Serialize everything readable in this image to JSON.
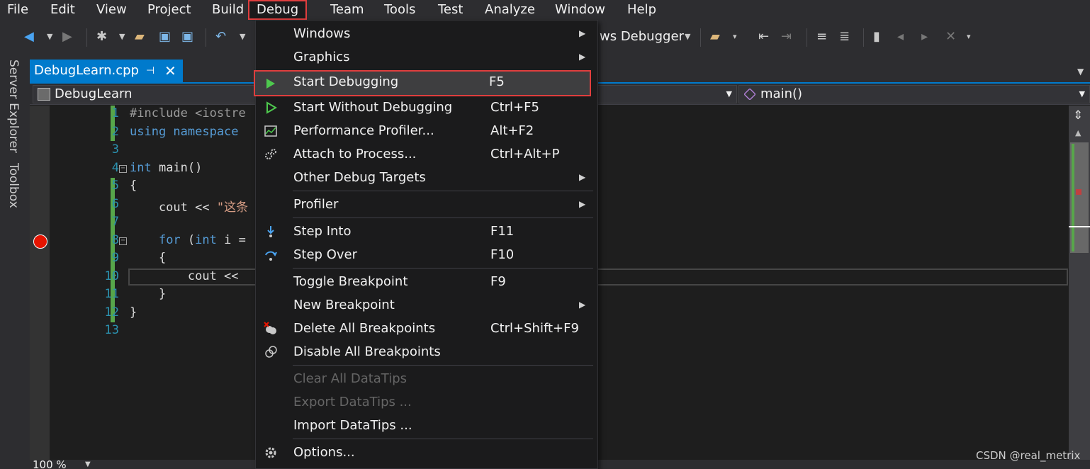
{
  "menubar": {
    "items": [
      "File",
      "Edit",
      "View",
      "Project",
      "Build",
      "Debug",
      "Team",
      "Tools",
      "Test",
      "Analyze",
      "Window",
      "Help"
    ],
    "active": "Debug"
  },
  "toolbar": {
    "debugger_label": "ws Debugger"
  },
  "side_tabs": [
    "Server Explorer",
    "Toolbox"
  ],
  "doc_tab": {
    "name": "DebugLearn.cpp"
  },
  "navbar": {
    "project": "DebugLearn",
    "member": "main()"
  },
  "editor": {
    "line_numbers": [
      "1",
      "2",
      "3",
      "4",
      "5",
      "6",
      "7",
      "8",
      "9",
      "10",
      "11",
      "12",
      "13"
    ],
    "lines": [
      {
        "tokens": [
          {
            "c": "pp",
            "t": "#include <iostre"
          }
        ]
      },
      {
        "tokens": [
          {
            "c": "kw",
            "t": "using namespace"
          }
        ]
      },
      {
        "tokens": []
      },
      {
        "tokens": [
          {
            "c": "kw",
            "t": "int"
          },
          {
            "c": "tx",
            "t": " main()"
          }
        ]
      },
      {
        "tokens": [
          {
            "c": "tx",
            "t": "{"
          }
        ]
      },
      {
        "tokens": [
          {
            "c": "tx",
            "t": "    cout << "
          },
          {
            "c": "st",
            "t": "\"这条"
          }
        ]
      },
      {
        "tokens": []
      },
      {
        "tokens": [
          {
            "c": "tx",
            "t": "    "
          },
          {
            "c": "kw",
            "t": "for"
          },
          {
            "c": "tx",
            "t": " ("
          },
          {
            "c": "kw",
            "t": "int"
          },
          {
            "c": "tx",
            "t": " i ="
          }
        ]
      },
      {
        "tokens": [
          {
            "c": "tx",
            "t": "    {"
          }
        ]
      },
      {
        "tokens": [
          {
            "c": "tx",
            "t": "        cout <<"
          }
        ]
      },
      {
        "tokens": [
          {
            "c": "tx",
            "t": "    }"
          }
        ]
      },
      {
        "tokens": [
          {
            "c": "tx",
            "t": "}"
          }
        ]
      },
      {
        "tokens": []
      }
    ],
    "breakpoint_line": 8
  },
  "zoom": "100 %",
  "debug_menu": {
    "items": [
      {
        "label": "Windows",
        "shortcut": "",
        "submenu": true,
        "icon": ""
      },
      {
        "label": "Graphics",
        "shortcut": "",
        "submenu": true,
        "icon": ""
      },
      {
        "label": "Start Debugging",
        "shortcut": "F5",
        "submenu": false,
        "icon": "play-icon",
        "highlighted": true
      },
      {
        "label": "Start Without Debugging",
        "shortcut": "Ctrl+F5",
        "submenu": false,
        "icon": "play-outline-icon"
      },
      {
        "label": "Performance Profiler...",
        "shortcut": "Alt+F2",
        "submenu": false,
        "icon": "profiler-icon"
      },
      {
        "label": "Attach to Process...",
        "shortcut": "Ctrl+Alt+P",
        "submenu": false,
        "icon": "gears-icon"
      },
      {
        "label": "Other Debug Targets",
        "shortcut": "",
        "submenu": true,
        "icon": ""
      },
      {
        "label": "Profiler",
        "shortcut": "",
        "submenu": true,
        "icon": ""
      },
      {
        "label": "Step Into",
        "shortcut": "F11",
        "submenu": false,
        "icon": "step-into-icon"
      },
      {
        "label": "Step Over",
        "shortcut": "F10",
        "submenu": false,
        "icon": "step-over-icon"
      },
      {
        "label": "Toggle Breakpoint",
        "shortcut": "F9",
        "submenu": false,
        "icon": ""
      },
      {
        "label": "New Breakpoint",
        "shortcut": "",
        "submenu": true,
        "icon": ""
      },
      {
        "label": "Delete All Breakpoints",
        "shortcut": "Ctrl+Shift+F9",
        "submenu": false,
        "icon": "delete-breakpoints-icon"
      },
      {
        "label": "Disable All Breakpoints",
        "shortcut": "",
        "submenu": false,
        "icon": "disable-breakpoints-icon"
      },
      {
        "label": "Clear All DataTips",
        "shortcut": "",
        "submenu": false,
        "icon": "",
        "disabled": true
      },
      {
        "label": "Export DataTips ...",
        "shortcut": "",
        "submenu": false,
        "icon": "",
        "disabled": true
      },
      {
        "label": "Import DataTips ...",
        "shortcut": "",
        "submenu": false,
        "icon": ""
      },
      {
        "label": "Options...",
        "shortcut": "",
        "submenu": false,
        "icon": "gear-icon"
      }
    ]
  },
  "watermark": "CSDN @real_metrix",
  "colors": {
    "accent": "#007acc",
    "highlight_border": "#e03e3e",
    "breakpoint": "#e51400",
    "change_bar": "#57a64a"
  }
}
